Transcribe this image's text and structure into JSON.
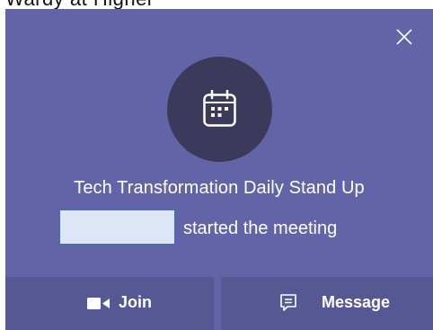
{
  "background_text": "Wardy at Higher",
  "notification": {
    "title": "Tech Transformation Daily Stand Up",
    "subtitle": "started the meeting",
    "organizer_name": ""
  },
  "actions": {
    "join_label": "Join",
    "message_label": "Message"
  },
  "icons": {
    "close": "close-icon",
    "calendar": "calendar-icon",
    "join": "video-camera-icon",
    "message": "chat-icon"
  },
  "colors": {
    "toast_bg": "#6264a7",
    "action_bar_bg": "#565894",
    "avatar_bg": "#3b3a5a",
    "redaction_fill": "#dce6f7",
    "redaction_border": "#4a6fb0",
    "text": "#ffffff"
  }
}
